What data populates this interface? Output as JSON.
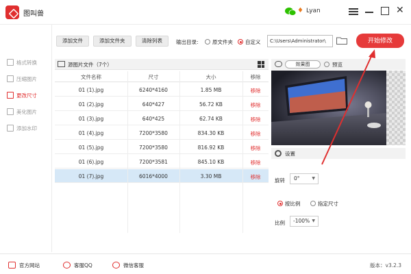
{
  "app": {
    "title": "图叫兽",
    "user_name": "Lyan"
  },
  "title_bar": {
    "icons": [
      "wechat-icon",
      "vip-icon",
      "menu-icon",
      "minimize-icon",
      "maximize-icon",
      "close-icon"
    ],
    "vip_glyph": "♦",
    "close_glyph": "✕"
  },
  "sidebar": {
    "items": [
      {
        "label": "格式转换",
        "icon": "format-convert-icon",
        "active": false
      },
      {
        "label": "压缩图片",
        "icon": "compress-icon",
        "active": false
      },
      {
        "label": "更改尺寸",
        "icon": "resize-icon",
        "active": true
      },
      {
        "label": "美化图片",
        "icon": "beautify-icon",
        "active": false
      },
      {
        "label": "添加水印",
        "icon": "watermark-icon",
        "active": false
      }
    ]
  },
  "toolbar": {
    "add_file": "添加文件",
    "add_folder": "添加文件夹",
    "clear_list": "清除列表",
    "output_label": "输出目录:",
    "option_original": "原文件夹",
    "option_custom": "自定义",
    "selected_option": "自定义",
    "output_path": "C:\\Users\\Administrator\\",
    "start_button": "开始修改"
  },
  "file_panel": {
    "title": "源图片文件（7个）",
    "columns": [
      "文件名称",
      "尺寸",
      "大小",
      "移除"
    ],
    "rows": [
      {
        "name": "01 (1).jpg",
        "size": "6240*4160",
        "filesize": "1.85 MB",
        "remove": "移除"
      },
      {
        "name": "01 (2).jpg",
        "size": "640*427",
        "filesize": "56.72 KB",
        "remove": "移除"
      },
      {
        "name": "01 (3).jpg",
        "size": "640*425",
        "filesize": "62.74 KB",
        "remove": "移除"
      },
      {
        "name": "01 (4).jpg",
        "size": "7200*3580",
        "filesize": "834.30 KB",
        "remove": "移除"
      },
      {
        "name": "01 (5).jpg",
        "size": "7200*3580",
        "filesize": "816.92 KB",
        "remove": "移除"
      },
      {
        "name": "01 (6).jpg",
        "size": "7200*3581",
        "filesize": "845.10 KB",
        "remove": "移除"
      },
      {
        "name": "01 (7).jpg",
        "size": "6016*4000",
        "filesize": "3.30 MB",
        "remove": "移除"
      }
    ],
    "selected_row": 6
  },
  "preview": {
    "mode": "效果图",
    "label": "预览"
  },
  "settings": {
    "title": "设置",
    "rotate_label": "旋转",
    "rotate_value": "0°",
    "option_ratio": "按比例",
    "option_size": "指定尺寸",
    "selected_option": "按比例",
    "ratio_label": "比例",
    "ratio_value": "-100%"
  },
  "status_bar": {
    "website": "官方网站",
    "qq": "客服QQ",
    "wechat": "微信客服",
    "version": "版本：v3.2.3"
  },
  "colors": {
    "accent": "#e02f2f",
    "start_button": "#e63a3a",
    "selected_row": "#d6e8f7",
    "annotation_arrow": "#e02f2f"
  }
}
